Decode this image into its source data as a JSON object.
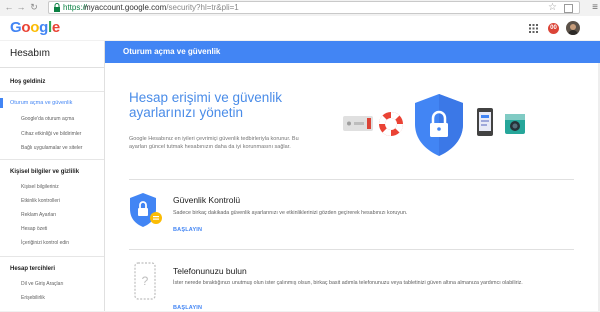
{
  "browser": {
    "url_scheme": "https://",
    "url_host": "myaccount.google.com",
    "url_path": "/security?hl=tr&pli=1",
    "icons": [
      "back-icon",
      "forward-icon",
      "reload-icon",
      "lock-icon",
      "star-icon",
      "menu-icon"
    ]
  },
  "header": {
    "logo_letters": [
      "G",
      "o",
      "o",
      "g",
      "l",
      "e"
    ],
    "notification_badge": "00",
    "colors": {
      "blue": "#4285f4",
      "red": "#ea4335",
      "yellow": "#fbbc05",
      "green": "#34a853"
    }
  },
  "sidebar": {
    "title": "Hesabım",
    "welcome": "Hoş geldiniz",
    "sections": [
      {
        "label": "Oturum açma ve güvenlik",
        "active": true,
        "items": [
          "Google'da oturum açma",
          "Cihaz etkinliği ve bildirimler",
          "Bağlı uygulamalar ve siteler"
        ]
      },
      {
        "label": "Kişisel bilgiler ve gizlilik",
        "items": [
          "Kişisel bilgileriniz",
          "Etkinlik kontrolleri",
          "Reklam Ayarları",
          "Hesap özeti",
          "İçeriğinizi kontrol edin"
        ]
      },
      {
        "label": "Hesap tercihleri",
        "items": [
          "Dil ve Giriş Araçları",
          "Erişebilirlik"
        ]
      }
    ]
  },
  "main": {
    "banner_title": "Oturum açma ve güvenlik",
    "hero_title": "Hesap erişimi ve güvenlik ayarlarınızı yönetin",
    "hero_desc": "Google Hesabınız en iyileri çevrimiçi güvenlik tedbirleriyla korunur. Bu ayarları güncel tutmak hesabınızın daha da iyi korunmasını sağlar.",
    "sections": [
      {
        "title": "Güvenlik Kontrolü",
        "desc": "Sadece birkaç dakikada güvenlik ayarlarınızı ve etkinliklerinizi gözden geçirerek hesabınızı koruyun.",
        "link": "BAŞLAYIN"
      },
      {
        "title": "Telefonunuzu bulun",
        "desc": "İster nerede bıraktığınızı unutmuş olun ister çalınmış olsun, birkaç basit adımla telefonunuzu veya tabletinizi güven altına almanıza yardımcı olabiliriz.",
        "link": "BAŞLAYIN"
      }
    ],
    "accent": "#4285f4"
  }
}
